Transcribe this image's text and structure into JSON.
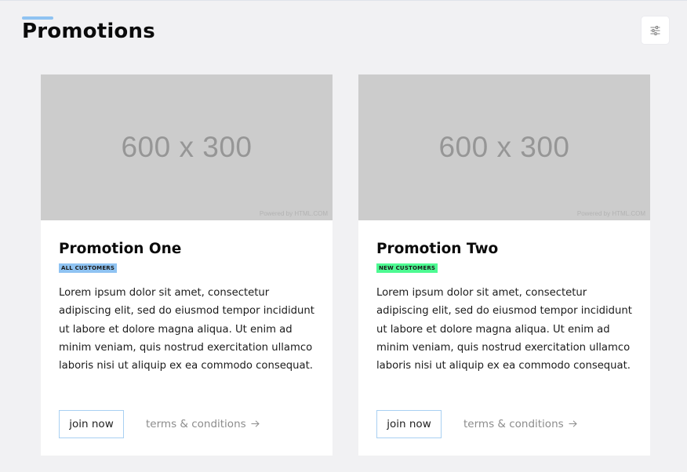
{
  "page": {
    "title": "Promotions"
  },
  "header": {
    "filter_icon": "sliders-icon"
  },
  "colors": {
    "accent": "#8fc3f2",
    "badge_all": "#8fc3f2",
    "badge_new": "#4dfa92",
    "background": "#f1f1f3"
  },
  "cards": [
    {
      "image_placeholder": "600 x 300",
      "image_credit": "Powered by HTML.COM",
      "title": "Promotion One",
      "badge": "ALL CUSTOMERS",
      "body": "Lorem ipsum dolor sit amet, consectetur adipiscing elit, sed do eiusmod tempor incididunt ut labore et dolore magna aliqua. Ut enim ad minim veniam, quis nostrud exercitation ullamco laboris nisi ut aliquip ex ea commodo consequat.",
      "cta_label": "join now",
      "terms_label": "terms & conditions"
    },
    {
      "image_placeholder": "600 x 300",
      "image_credit": "Powered by HTML.COM",
      "title": "Promotion Two",
      "badge": "NEW CUSTOMERS",
      "body": "Lorem ipsum dolor sit amet, consectetur adipiscing elit, sed do eiusmod tempor incididunt ut labore et dolore magna aliqua. Ut enim ad minim veniam, quis nostrud exercitation ullamco laboris nisi ut aliquip ex ea commodo consequat.",
      "cta_label": "join now",
      "terms_label": "terms & conditions"
    }
  ]
}
